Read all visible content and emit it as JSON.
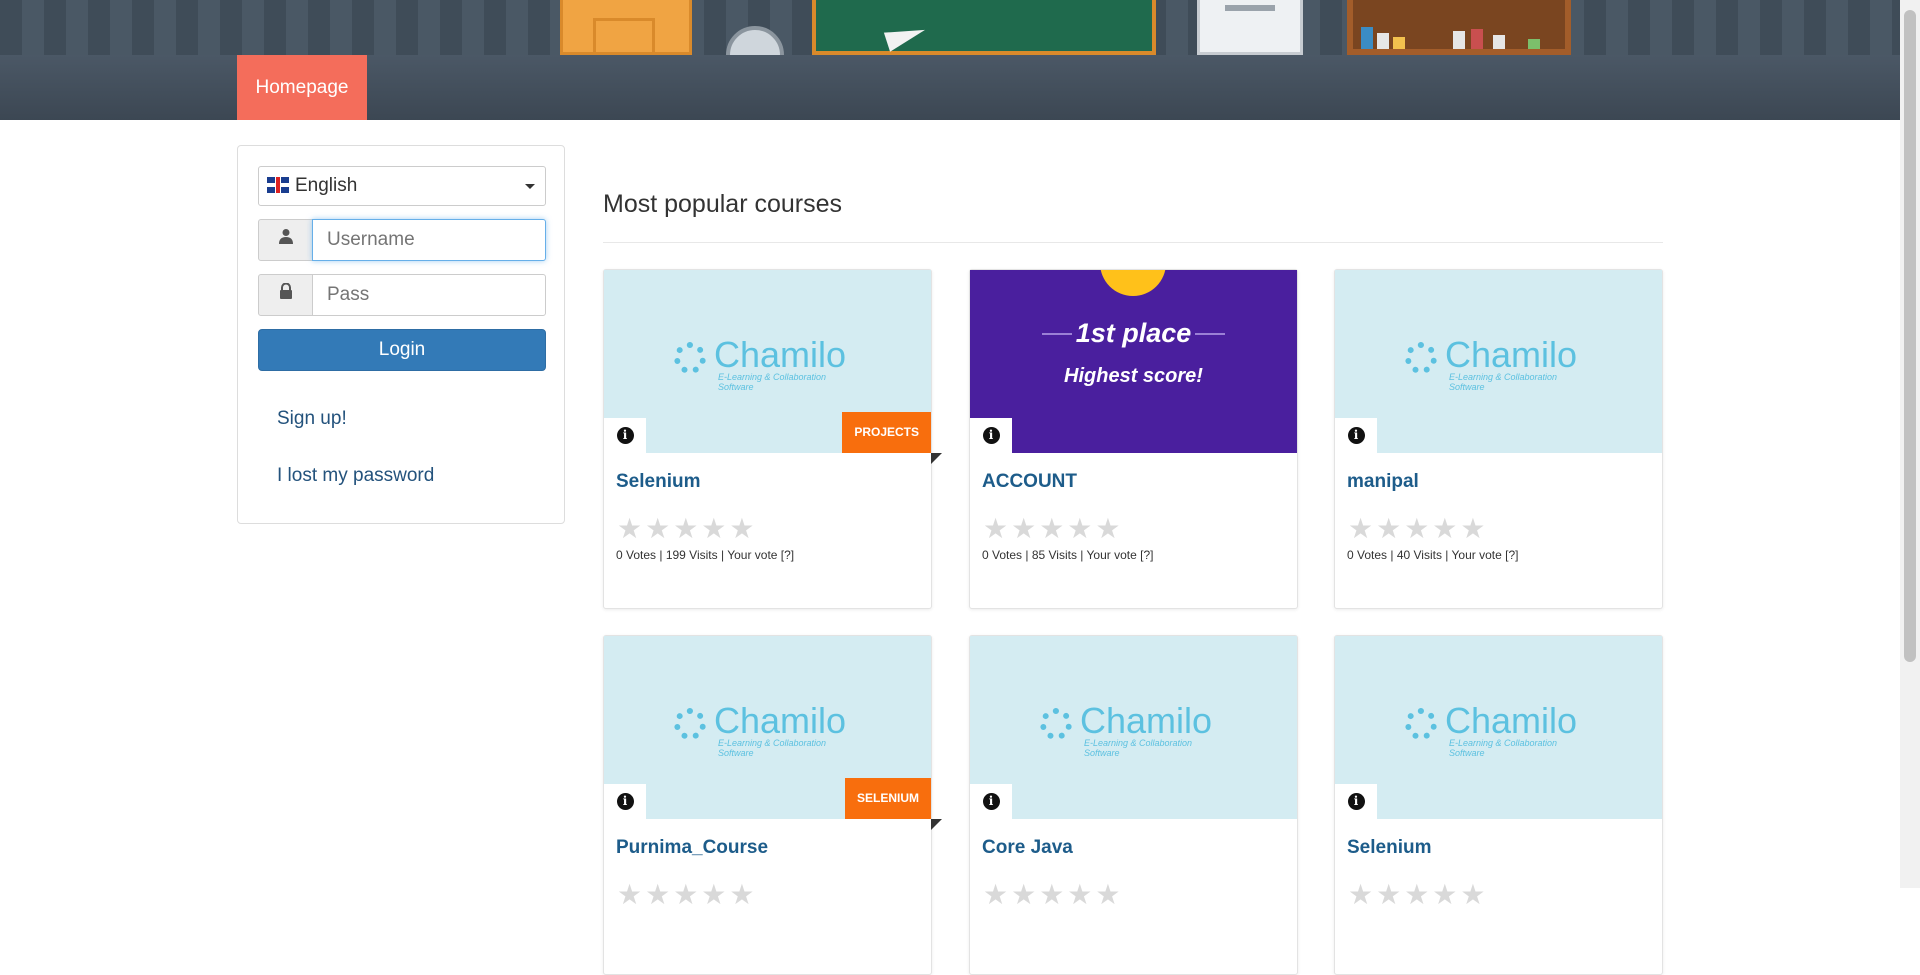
{
  "nav": {
    "home": "Homepage"
  },
  "login": {
    "language": "English",
    "username_placeholder": "Username",
    "password_placeholder": "Pass",
    "login_label": "Login",
    "signup_label": "Sign up!",
    "lost_password_label": "I lost my password"
  },
  "main": {
    "title": "Most popular courses",
    "courses": [
      {
        "title": "Selenium",
        "badge": "PROJECTS",
        "logo": "Chamilo",
        "logo_tag": "E-Learning & Collaboration Software",
        "stats": "0 Votes | 199 Visits | Your vote [?]"
      },
      {
        "title": "ACCOUNT",
        "badge": "",
        "image_place": "1st place",
        "image_score": "Highest score!",
        "stats": "0 Votes | 85 Visits | Your vote [?]"
      },
      {
        "title": "manipal",
        "badge": "",
        "logo": "Chamilo",
        "logo_tag": "E-Learning & Collaboration Software",
        "stats": "0 Votes | 40 Visits | Your vote [?]"
      },
      {
        "title": "Purnima_Course",
        "badge": "SELENIUM",
        "logo": "Chamilo",
        "logo_tag": "E-Learning & Collaboration Software",
        "stats": ""
      },
      {
        "title": "Core Java",
        "badge": "",
        "logo": "Chamilo",
        "logo_tag": "E-Learning & Collaboration Software",
        "stats": ""
      },
      {
        "title": "Selenium",
        "badge": "",
        "logo": "Chamilo",
        "logo_tag": "E-Learning & Collaboration Software",
        "stats": ""
      }
    ],
    "rating_stars": "★★★★★",
    "info_glyph": "i"
  },
  "colors": {
    "accent": "#f46d5b",
    "primary": "#337ab7",
    "badge": "#f86e0d",
    "link": "#23527c"
  }
}
